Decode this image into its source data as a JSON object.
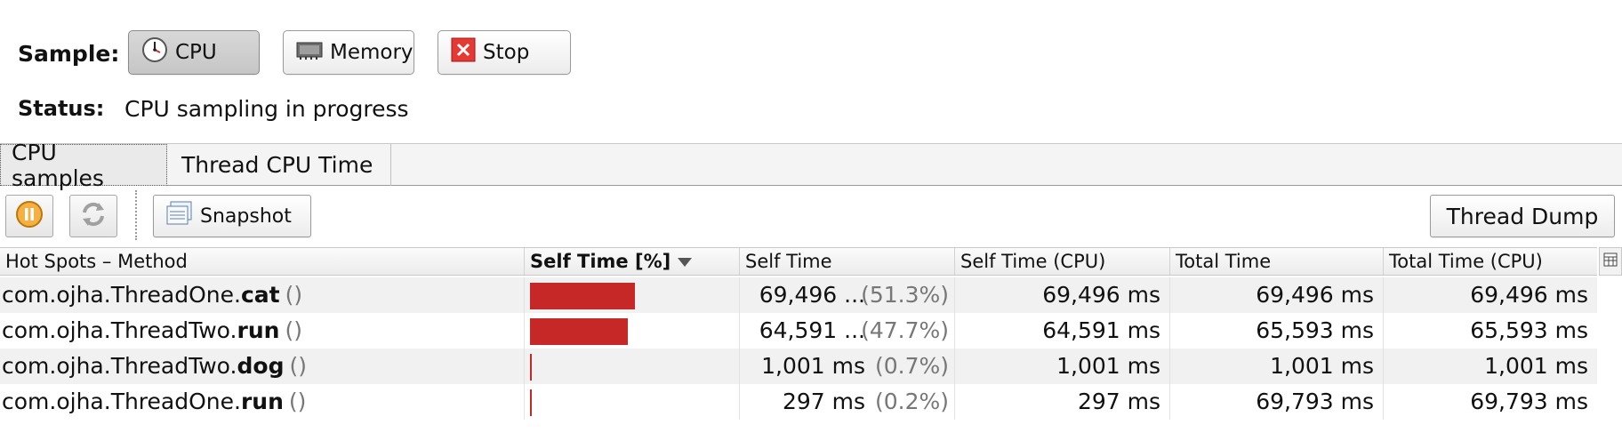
{
  "sample": {
    "label": "Sample:",
    "buttons": [
      {
        "label": "CPU",
        "icon": "clock-icon",
        "pressed": true
      },
      {
        "label": "Memory",
        "icon": "memory-chip-icon",
        "pressed": false
      },
      {
        "label": "Stop",
        "icon": "stop-x-icon",
        "pressed": false
      }
    ]
  },
  "status": {
    "label": "Status:",
    "value": "CPU sampling in progress"
  },
  "tabs": [
    {
      "label": "CPU samples",
      "active": true
    },
    {
      "label": "Thread CPU Time",
      "active": false
    }
  ],
  "toolbar": {
    "pause_icon": "pause-icon",
    "refresh_icon": "refresh-icon",
    "snapshot_label": "Snapshot",
    "thread_dump_label": "Thread Dump"
  },
  "table": {
    "columns": [
      "Hot Spots – Method",
      "Self Time [%]",
      "Self Time",
      "Self Time (CPU)",
      "Total Time",
      "Total Time (CPU)"
    ],
    "sorted_column": "Self Time [%]",
    "rows": [
      {
        "class": "com.ojha.ThreadOne.",
        "method": "cat",
        "parens": "()",
        "self_pct": 51.3,
        "self_time": "69,496 ...",
        "self_pct_label": "(51.3%)",
        "self_cpu": "69,496 ms",
        "total": "69,496 ms",
        "total_cpu": "69,496 ms"
      },
      {
        "class": "com.ojha.ThreadTwo.",
        "method": "run",
        "parens": "()",
        "self_pct": 47.7,
        "self_time": "64,591 ...",
        "self_pct_label": "(47.7%)",
        "self_cpu": "64,591 ms",
        "total": "65,593 ms",
        "total_cpu": "65,593 ms"
      },
      {
        "class": "com.ojha.ThreadTwo.",
        "method": "dog",
        "parens": "()",
        "self_pct": 0.7,
        "self_time": "1,001 ms",
        "self_pct_label": "(0.7%)",
        "self_cpu": "1,001 ms",
        "total": "1,001 ms",
        "total_cpu": "1,001 ms"
      },
      {
        "class": "com.ojha.ThreadOne.",
        "method": "run",
        "parens": "()",
        "self_pct": 0.2,
        "self_time": "297 ms",
        "self_pct_label": "(0.2%)",
        "self_cpu": "297 ms",
        "total": "69,793 ms",
        "total_cpu": "69,793 ms"
      }
    ]
  },
  "colors": {
    "bar": "#c62828",
    "stop_red": "#e53935"
  }
}
